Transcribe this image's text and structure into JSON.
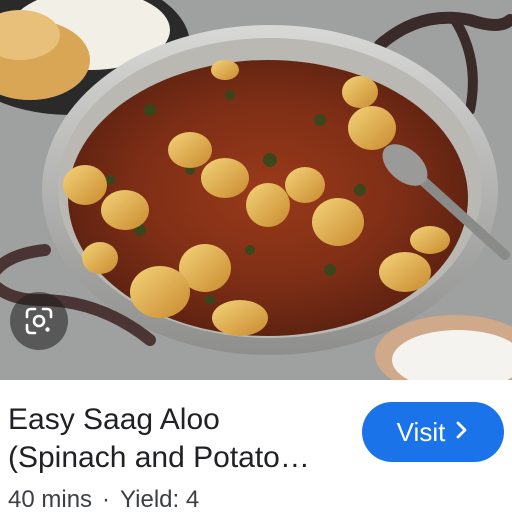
{
  "image": {
    "alt": "Saag aloo curry with potatoes and spinach in a pan",
    "lens_icon": "google-lens-icon"
  },
  "result": {
    "title_line1": "Easy Saag Aloo",
    "title_line2": "(Spinach and Potato…",
    "time": "40 mins",
    "separator": "·",
    "yield": "Yield: 4"
  },
  "visit": {
    "label": "Visit",
    "icon": "chevron-right-icon"
  },
  "colors": {
    "accent": "#1a73e8",
    "text": "#202124"
  }
}
